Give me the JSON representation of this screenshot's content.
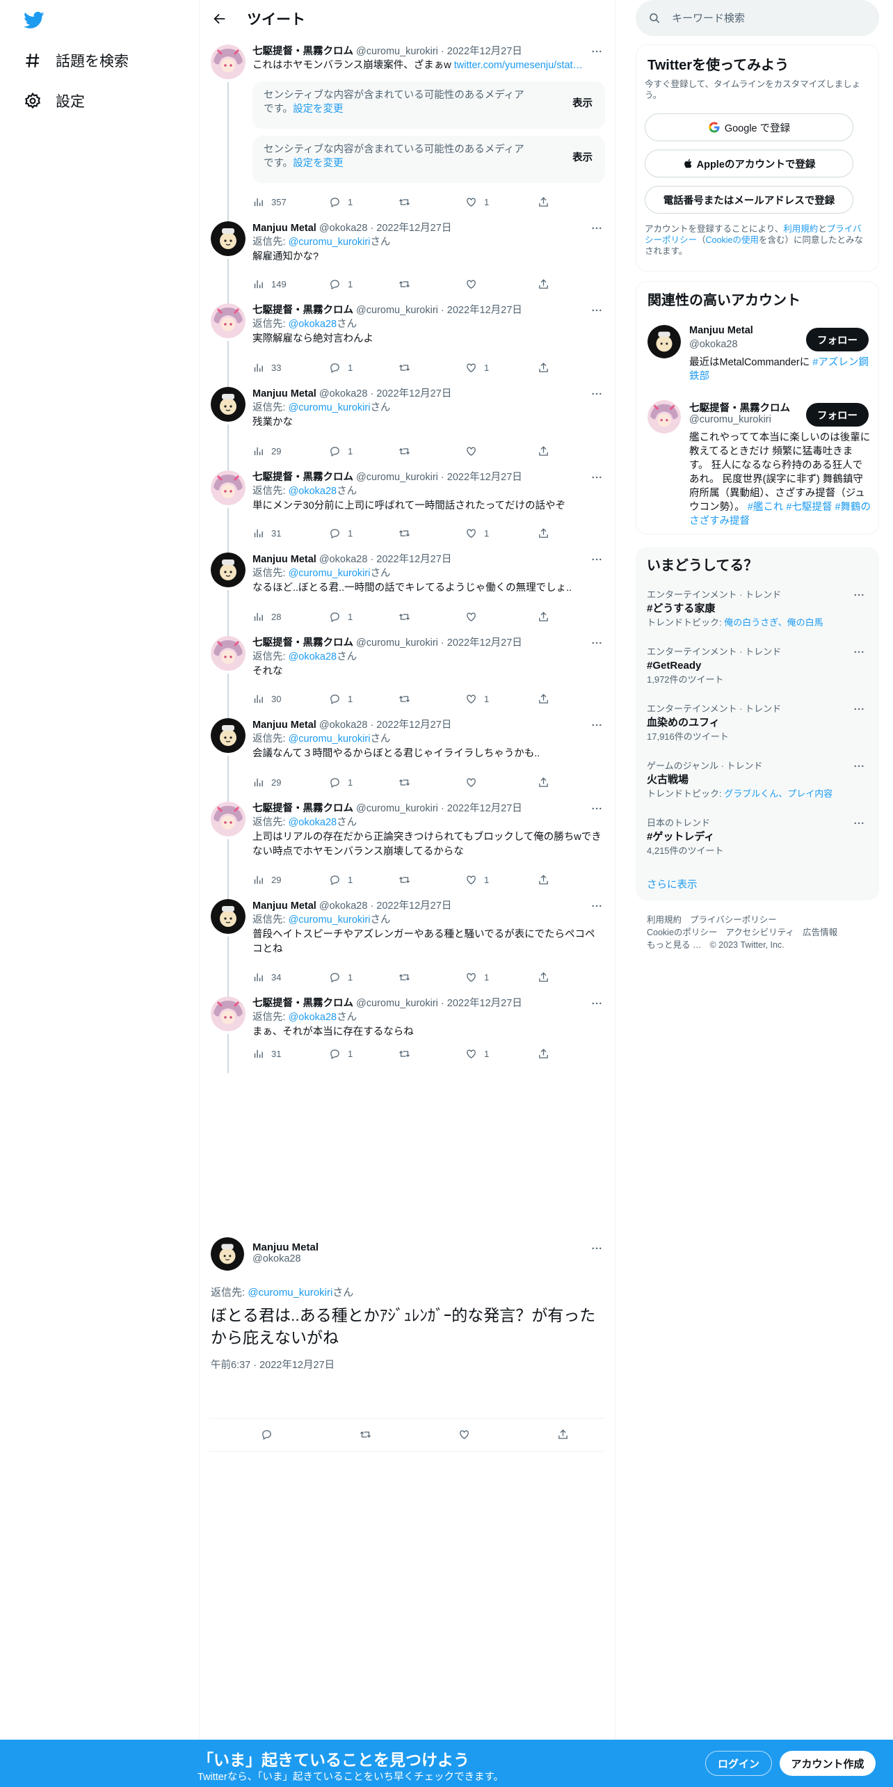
{
  "nav": {
    "explore_label": "話題を検索",
    "settings_label": "設定"
  },
  "header": {
    "title": "ツイート"
  },
  "tweets": [
    {
      "name": "七駆提督・黒霧クロム",
      "meta": "@curomu_kurokiri · 2022年12月27日",
      "text": "これはホヤモンバランス崩壊案件、ざまぁw",
      "link": "twitter.com/yumesenju/stat…",
      "sensitive_text": "センシティブな内容が含まれている可能性のあるメディアです。",
      "settings_link": "設定を変更",
      "show_label": "表示",
      "views": "357",
      "replies": "1",
      "retweets": "",
      "likes": "1"
    },
    {
      "name": "Manjuu Metal",
      "meta": "@okoka28 · 2022年12月27日",
      "reply_prefix": "返信先: ",
      "reply_to": "@curomu_kurokiri",
      "reply_suffix": "さん",
      "text": "解雇通知かな?",
      "views": "149",
      "replies": "1",
      "retweets": "",
      "likes": ""
    },
    {
      "name": "七駆提督・黒霧クロム",
      "meta": "@curomu_kurokiri · 2022年12月27日",
      "reply_prefix": "返信先: ",
      "reply_to": "@okoka28",
      "reply_suffix": "さん",
      "text": "実際解雇なら絶対言わんよ",
      "views": "33",
      "replies": "1",
      "retweets": "",
      "likes": "1"
    },
    {
      "name": "Manjuu Metal",
      "meta": "@okoka28 · 2022年12月27日",
      "reply_prefix": "返信先: ",
      "reply_to": "@curomu_kurokiri",
      "reply_suffix": "さん",
      "text": "残業かな",
      "views": "29",
      "replies": "1",
      "retweets": "",
      "likes": ""
    },
    {
      "name": "七駆提督・黒霧クロム",
      "meta": "@curomu_kurokiri · 2022年12月27日",
      "reply_prefix": "返信先: ",
      "reply_to": "@okoka28",
      "reply_suffix": "さん",
      "text": "単にメンテ30分前に上司に呼ばれて一時間話されたってだけの話やぞ",
      "views": "31",
      "replies": "1",
      "retweets": "",
      "likes": "1"
    },
    {
      "name": "Manjuu Metal",
      "meta": "@okoka28 · 2022年12月27日",
      "reply_prefix": "返信先: ",
      "reply_to": "@curomu_kurokiri",
      "reply_suffix": "さん",
      "text": "なるほど..ぼとる君..一時間の話でキレてるようじゃ働くの無理でしょ..",
      "views": "28",
      "replies": "1",
      "retweets": "",
      "likes": ""
    },
    {
      "name": "七駆提督・黒霧クロム",
      "meta": "@curomu_kurokiri · 2022年12月27日",
      "reply_prefix": "返信先: ",
      "reply_to": "@okoka28",
      "reply_suffix": "さん",
      "text": "それな",
      "views": "30",
      "replies": "1",
      "retweets": "",
      "likes": "1"
    },
    {
      "name": "Manjuu Metal",
      "meta": "@okoka28 · 2022年12月27日",
      "reply_prefix": "返信先: ",
      "reply_to": "@curomu_kurokiri",
      "reply_suffix": "さん",
      "text": "会議なんて３時間やるからぼとる君じゃイライラしちゃうかも..",
      "views": "29",
      "replies": "1",
      "retweets": "",
      "likes": ""
    },
    {
      "name": "七駆提督・黒霧クロム",
      "meta": "@curomu_kurokiri · 2022年12月27日",
      "reply_prefix": "返信先: ",
      "reply_to": "@okoka28",
      "reply_suffix": "さん",
      "text": "上司はリアルの存在だから正論突きつけられてもブロックして俺の勝ちwできない時点でホヤモンバランス崩壊してるからな",
      "views": "29",
      "replies": "1",
      "retweets": "",
      "likes": "1"
    },
    {
      "name": "Manjuu Metal",
      "meta": "@okoka28 · 2022年12月27日",
      "reply_prefix": "返信先: ",
      "reply_to": "@curomu_kurokiri",
      "reply_suffix": "さん",
      "text": "普段ヘイトスピーチやアズレンガーやある種と騒いでるが表にでたらペコペコとね",
      "views": "34",
      "replies": "1",
      "retweets": "",
      "likes": "1"
    },
    {
      "name": "七駆提督・黒霧クロム",
      "meta": "@curomu_kurokiri · 2022年12月27日",
      "reply_prefix": "返信先: ",
      "reply_to": "@okoka28",
      "reply_suffix": "さん",
      "text": "まぁ、それが本当に存在するならね",
      "views": "31",
      "replies": "1",
      "retweets": "",
      "likes": "1"
    }
  ],
  "focused": {
    "name": "Manjuu Metal",
    "handle": "@okoka28",
    "reply_prefix": "返信先: ",
    "reply_to": "@curomu_kurokiri",
    "reply_suffix": "さん",
    "text": "ぼとる君は..ある種とかｱｼﾞｭﾚﾝｶﾞｰ的な発言？が有ったから庇えないがね",
    "time": "午前6:37 · 2022年12月27日"
  },
  "search": {
    "placeholder": "キーワード検索"
  },
  "signup_card": {
    "title": "Twitterを使ってみよう",
    "subtitle": "今すぐ登録して、タイムラインをカスタマイズしましょう。",
    "google": "Google で登録",
    "apple": "Appleのアカウントで登録",
    "phone": "電話番号またはメールアドレスで登録",
    "legal_prefix": "アカウントを登録することにより、",
    "legal_terms": "利用規約",
    "legal_and": "と",
    "legal_privacy": "プライバシーポリシー",
    "legal_paren_open": "（",
    "legal_cookie": "Cookieの使用",
    "legal_suffix": "を含む）に同意したとみなされます。"
  },
  "related": {
    "title": "関連性の高いアカウント",
    "follow_label": "フォロー",
    "accounts": [
      {
        "name": "Manjuu Metal",
        "handle": "@okoka28",
        "bio_text": "最近はMetalCommanderに ",
        "bio_tag": "#アズレン鋼鉄部"
      },
      {
        "name": "七駆提督・黒霧クロム",
        "handle": "@curomu_kurokiri",
        "bio_text": "艦これやってて本当に楽しいのは後輩に教えてるときだけ 頻繁に猛毒吐きます。 狂人になるなら矜持のある狂人であれ。 民度世界(誤字に非ず) 舞鶴鎮守府所属（異動組）、さざすみ提督（ジュウコン勢）。 ",
        "bio_tag": "#艦これ #七駆提督 #舞鶴のさざすみ提督"
      }
    ]
  },
  "trends": {
    "title": "いまどうしてる？",
    "items": [
      {
        "category": "エンターテインメント · トレンド",
        "name": "#どうする家康",
        "sub_prefix": "トレンドトピック: ",
        "sub_link": "俺の白うさぎ、俺の白馬",
        "sub": ""
      },
      {
        "category": "エンターテインメント · トレンド",
        "name": "#GetReady",
        "sub_prefix": "",
        "sub_link": "",
        "sub": "1,972件のツイート"
      },
      {
        "category": "エンターテインメント · トレンド",
        "name": "血染めのユフィ",
        "sub_prefix": "",
        "sub_link": "",
        "sub": "17,916件のツイート"
      },
      {
        "category": "ゲームのジャンル · トレンド",
        "name": "火古戦場",
        "sub_prefix": "トレンドトピック: ",
        "sub_link": "グラブルくん、プレイ内容",
        "sub": ""
      },
      {
        "category": "日本のトレンド",
        "name": "#ゲットレディ",
        "sub_prefix": "",
        "sub_link": "",
        "sub": "4,215件のツイート"
      }
    ],
    "show_more": "さらに表示"
  },
  "footer": {
    "terms": "利用規約",
    "privacy": "プライバシーポリシー",
    "cookie": "Cookieのポリシー",
    "accessibility": "アクセシビリティ",
    "ads": "広告情報",
    "more": "もっと見る …",
    "copyright": "© 2023 Twitter, Inc."
  },
  "bottom_bar": {
    "title": "「いま」起きていることを見つけよう",
    "subtitle": "Twitterなら、「いま」起きていることをいち早くチェックできます。",
    "login": "ログイン",
    "signup": "アカウント作成"
  },
  "colors": {
    "accent": "#1d9bf0",
    "text": "#0f1419",
    "secondary": "#536471",
    "divider": "#eff3f4"
  }
}
